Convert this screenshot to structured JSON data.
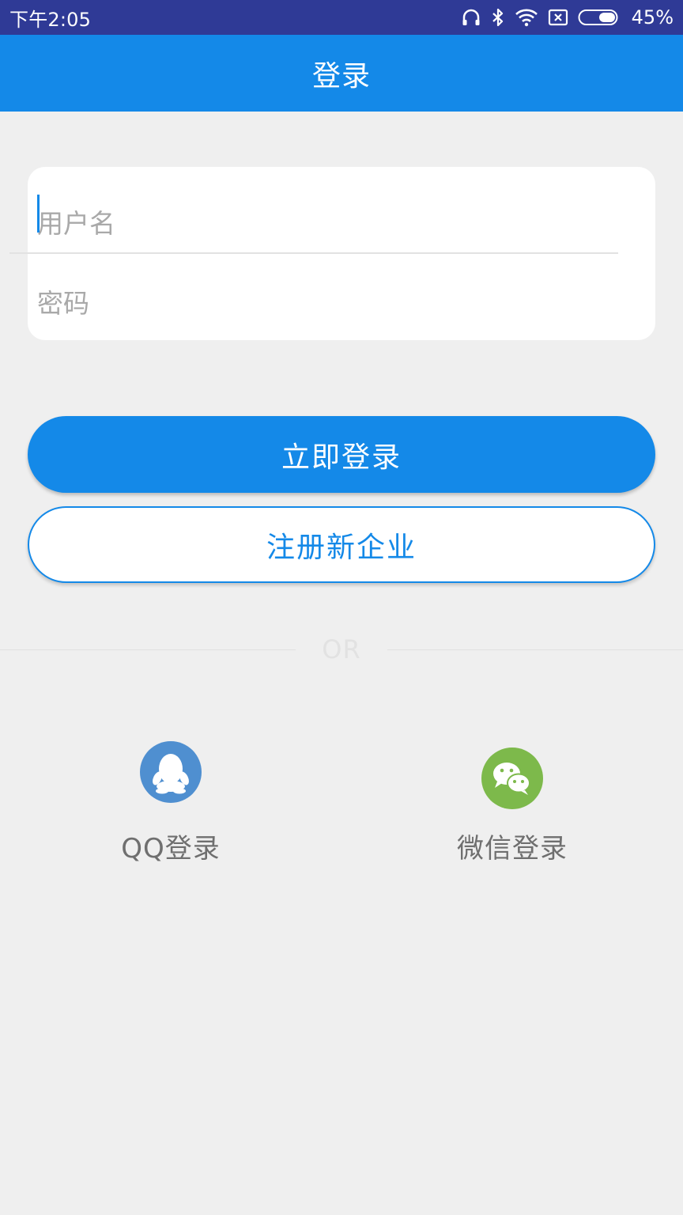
{
  "status_bar": {
    "time": "下午2:05",
    "battery_percent": "45%",
    "icons": [
      "headphones-icon",
      "bluetooth-icon",
      "wifi-icon",
      "no-sim-icon",
      "battery-icon"
    ]
  },
  "app_bar": {
    "title": "登录"
  },
  "form": {
    "username": {
      "placeholder": "用户名",
      "value": ""
    },
    "password": {
      "placeholder": "密码",
      "value": ""
    }
  },
  "buttons": {
    "login_label": "立即登录",
    "register_label": "注册新企业"
  },
  "separator": {
    "text": "OR"
  },
  "social": {
    "qq_label": "QQ登录",
    "wechat_label": "微信登录"
  },
  "colors": {
    "status_bar": "#2f3a96",
    "primary": "#1489e8",
    "background": "#efefef",
    "qq_icon": "#4f8fd0",
    "wechat_icon": "#7db94b"
  }
}
